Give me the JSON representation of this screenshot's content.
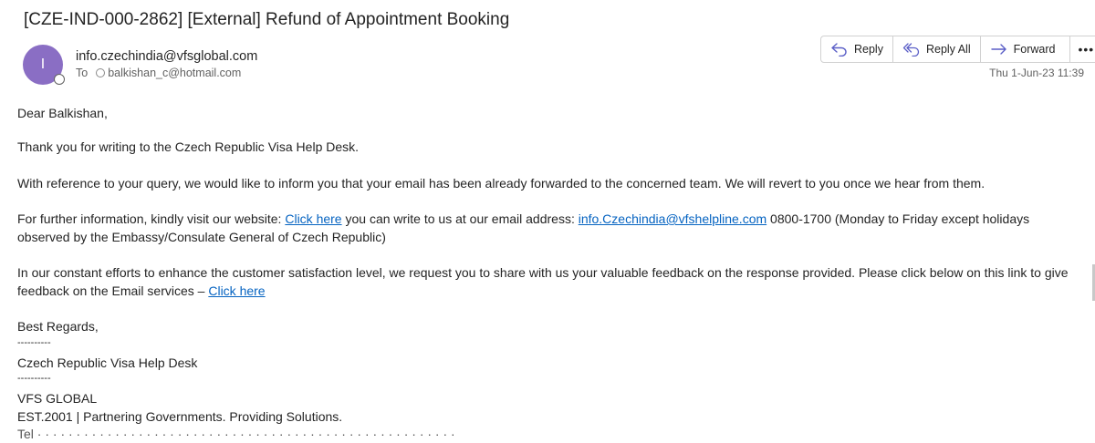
{
  "email": {
    "subject": "[CZE-IND-000-2862] [External] Refund of Appointment Booking",
    "avatar_initial": "I",
    "sender": "info.czechindia@vfsglobal.com",
    "to_label": "To",
    "recipient": "balkishan_c@hotmail.com",
    "date": "Thu 1-Jun-23 11:39",
    "accent_color": "#8a6ec4"
  },
  "actions": {
    "reply": "Reply",
    "reply_all": "Reply All",
    "forward": "Forward",
    "more": "•••"
  },
  "body": {
    "greeting": "Dear Balkishan,",
    "thanks": "Thank you for writing to the Czech Republic Visa Help Desk.",
    "reference": "With reference to your query, we would like to inform you that your email has been already forwarded to the concerned team. We will revert to you once we hear from them.",
    "further_pre": "For further information, kindly visit our website: ",
    "further_link": "Click here",
    "further_mid": " you can write to us at our email address: ",
    "further_email": "info.Czechindia@vfshelpline.com",
    "further_post": " 0800-1700 (Monday to Friday except holidays observed by the Embassy/Consulate General of Czech Republic)",
    "feedback_pre": "In our constant efforts to enhance the customer satisfaction level, we request you to share with us your valuable feedback on the response provided. Please click below on this link to give feedback on the Email services – ",
    "feedback_link": " Click here",
    "regards": "Best Regards,",
    "separator1": "----------",
    "signature_desk": "Czech Republic Visa Help Desk",
    "separator2": "----------",
    "company": "VFS GLOBAL",
    "tagline": "EST.2001 | Partnering Governments. Providing Solutions.",
    "truncated": "Tel · · · · · · · · · · · · · · · · · · · · · · · · · · · · · · · · · · · · · · · · · · · · · · · · · · · · · ·"
  }
}
